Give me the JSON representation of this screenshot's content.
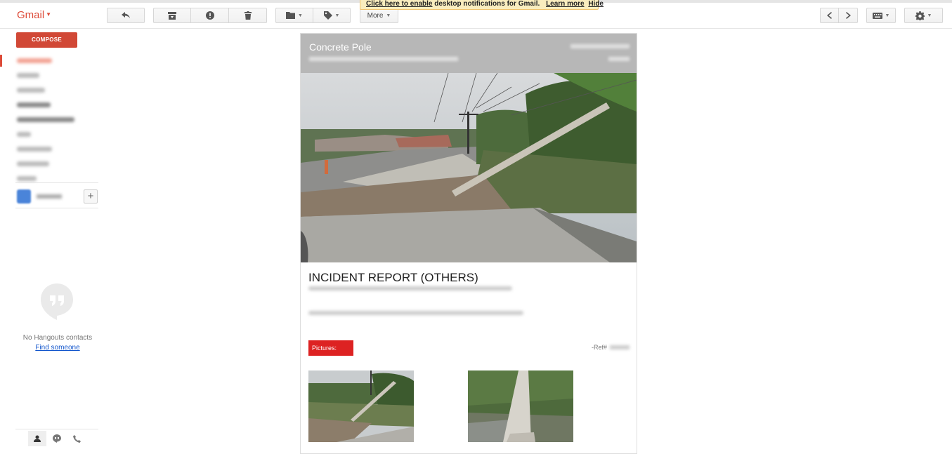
{
  "notification": {
    "enable_link": "Click here to enable",
    "message": " desktop notifications for Gmail.",
    "learn_more": "Learn more",
    "hide": "Hide"
  },
  "header": {
    "brand": "Gmail",
    "more_label": "More"
  },
  "sidebar": {
    "compose_label": "COMPOSE",
    "nav_items": [
      "Inbox",
      "Starred",
      "Sent Mail",
      "Drafts",
      "Label",
      "Label",
      "Label",
      "Label",
      "More"
    ],
    "hangouts_empty": "No Hangouts contacts",
    "find_someone": "Find someone"
  },
  "message": {
    "title": "Concrete Pole",
    "report_title": "INCIDENT REPORT (OTHERS)",
    "pictures_label": "Pictures:",
    "ref_label": "-Ref#"
  },
  "colors": {
    "brand": "#dd4b39",
    "compose": "#d14836",
    "header_bar": "#b7b7b7",
    "pictures_badge": "#dd2222"
  },
  "icons": [
    "reply-icon",
    "archive-icon",
    "report-spam-icon",
    "delete-icon",
    "folder-icon",
    "label-icon",
    "chevron-left-icon",
    "chevron-right-icon",
    "keyboard-icon",
    "gear-icon",
    "hangouts-icon",
    "person-icon",
    "chat-icon",
    "phone-icon"
  ]
}
